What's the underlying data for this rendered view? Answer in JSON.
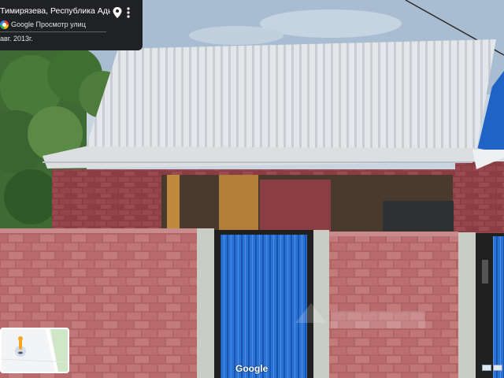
{
  "info_card": {
    "title": "Тимирязева, Республика Адыгея",
    "source_label": "Google Просмотр улиц",
    "date_label": "авг. 2013г.",
    "pin_icon": "map-pin-icon",
    "more_icon": "more-vert-icon"
  },
  "footer": {
    "brand_label": "Google"
  },
  "colors": {
    "card_bg": "#202124",
    "roof": "#dfe3e8",
    "brick": "#a9575a",
    "gate_blue": "#1f63c6",
    "pillar": "#c6c9c2",
    "trees": "#3c6b2f"
  }
}
